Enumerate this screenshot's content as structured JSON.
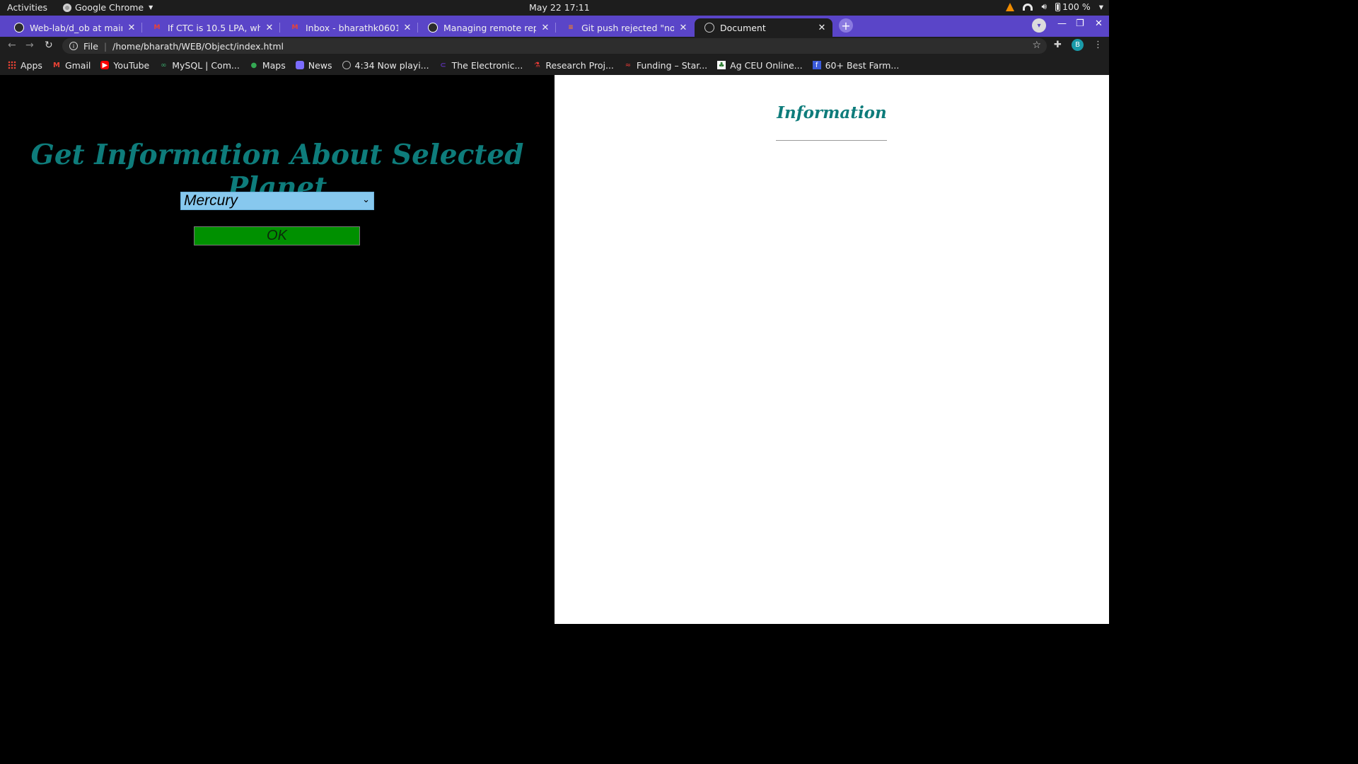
{
  "system_bar": {
    "activities": "Activities",
    "app_name": "Google Chrome",
    "datetime": "May 22  17:11",
    "battery": "100 %"
  },
  "tabs": [
    {
      "title": "Web-lab/d_ob at main · Bl",
      "icon": "github-icon",
      "active": false
    },
    {
      "title": "If CTC is 10.5 LPA, what w",
      "icon": "gmail-icon",
      "active": false
    },
    {
      "title": "Inbox - bharathk0601@gm",
      "icon": "gmail-icon",
      "active": false
    },
    {
      "title": "Managing remote reposit",
      "icon": "github-icon",
      "active": false
    },
    {
      "title": "Git push rejected \"non-fa",
      "icon": "stackoverflow-icon",
      "active": false
    },
    {
      "title": "Document",
      "icon": "globe-icon",
      "active": true
    }
  ],
  "profile_initial": "B",
  "omnibox": {
    "scheme": "File",
    "url": "/home/bharath/WEB/Object/index.html"
  },
  "bookmarks": [
    {
      "label": "Apps",
      "icon": "apps-grid-icon"
    },
    {
      "label": "Gmail",
      "icon": "gmail-icon"
    },
    {
      "label": "YouTube",
      "icon": "youtube-icon"
    },
    {
      "label": "MySQL | Com...",
      "icon": "mysql-icon"
    },
    {
      "label": "Maps",
      "icon": "maps-pin-icon"
    },
    {
      "label": "News",
      "icon": "news-icon"
    },
    {
      "label": "4:34 Now playi...",
      "icon": "globe-icon"
    },
    {
      "label": "The Electronic...",
      "icon": "edn-icon"
    },
    {
      "label": "Research Proj...",
      "icon": "research-icon"
    },
    {
      "label": "Funding – Star...",
      "icon": "funding-icon"
    },
    {
      "label": "Ag CEU Online...",
      "icon": "ag-ceu-icon"
    },
    {
      "label": "60+ Best Farm...",
      "icon": "farm-icon"
    }
  ],
  "page": {
    "heading": "Get Information About Selected Planet",
    "select": {
      "selected": "Mercury"
    },
    "ok_button": "OK",
    "info_heading": "Information"
  },
  "colors": {
    "tab_strip": "#5a45c8",
    "heading_teal": "#0e7c7b",
    "select_bg": "#87c8ee",
    "ok_bg": "#009000"
  }
}
